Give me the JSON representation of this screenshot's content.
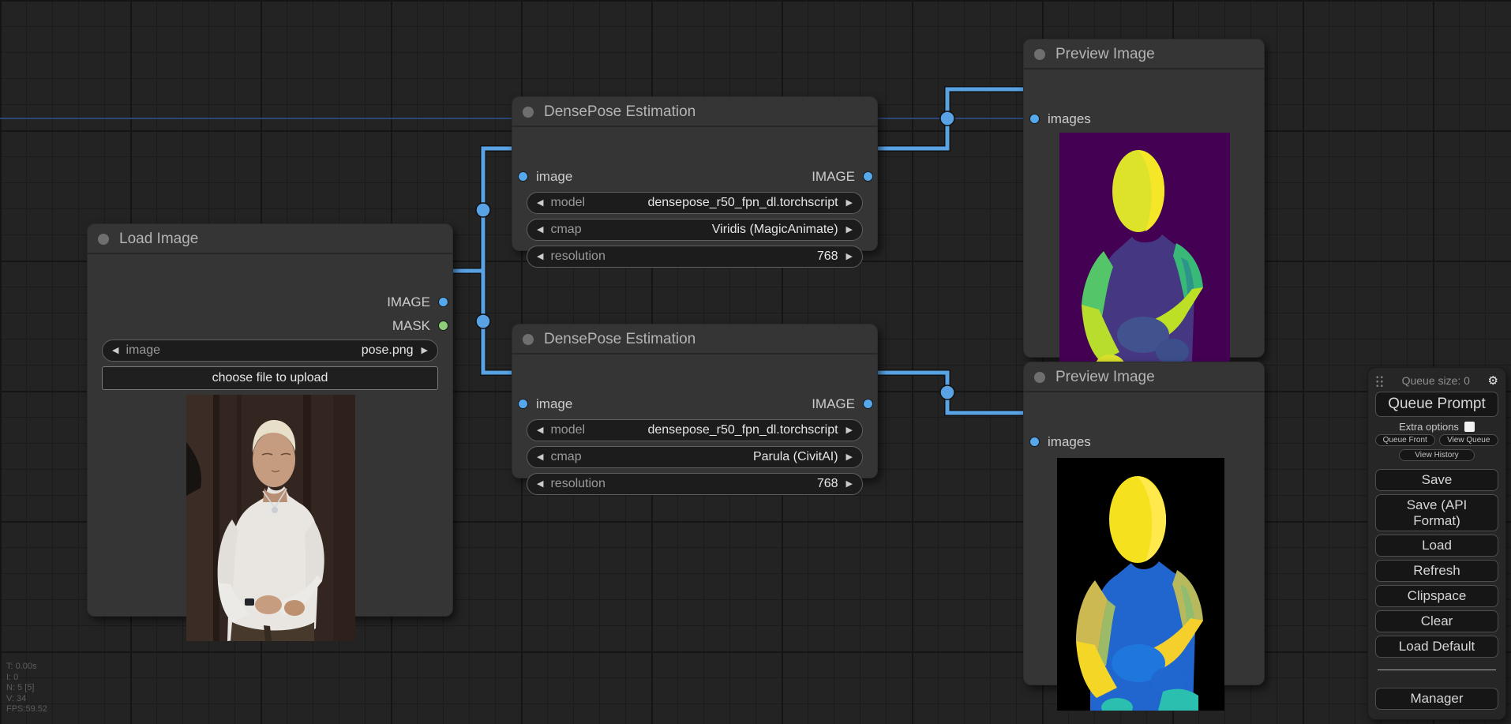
{
  "canvas": {
    "stats": [
      "T: 0.00s",
      "I: 0",
      "N: 5 [5]",
      "V: 34",
      "FPS:59.52"
    ]
  },
  "colors": {
    "link": "#59a2e4",
    "image_slot": "#55a8ec",
    "mask_slot": "#8fcc7a",
    "node_bg": "#353535",
    "canvas_bg": "#232323"
  },
  "nodes": {
    "load_image": {
      "title": "Load Image",
      "outputs": [
        {
          "label": "IMAGE"
        },
        {
          "label": "MASK"
        }
      ],
      "widgets": [
        {
          "label": "image",
          "value": "pose.png"
        }
      ],
      "upload_button": "choose file to upload",
      "image_name": "photo-man-white-shirt"
    },
    "densepose_1": {
      "title": "DensePose Estimation",
      "inputs": [
        {
          "label": "image"
        }
      ],
      "outputs": [
        {
          "label": "IMAGE"
        }
      ],
      "widgets": [
        {
          "label": "model",
          "value": "densepose_r50_fpn_dl.torchscript"
        },
        {
          "label": "cmap",
          "value": "Viridis (MagicAnimate)"
        },
        {
          "label": "resolution",
          "value": "768"
        }
      ]
    },
    "densepose_2": {
      "title": "DensePose Estimation",
      "inputs": [
        {
          "label": "image"
        }
      ],
      "outputs": [
        {
          "label": "IMAGE"
        }
      ],
      "widgets": [
        {
          "label": "model",
          "value": "densepose_r50_fpn_dl.torchscript"
        },
        {
          "label": "cmap",
          "value": "Parula (CivitAI)"
        },
        {
          "label": "resolution",
          "value": "768"
        }
      ]
    },
    "preview_1": {
      "title": "Preview Image",
      "inputs": [
        {
          "label": "images"
        }
      ],
      "image_name": "densepose-viridis-result"
    },
    "preview_2": {
      "title": "Preview Image",
      "inputs": [
        {
          "label": "images"
        }
      ],
      "image_name": "densepose-parula-result"
    }
  },
  "menu": {
    "queue_size": "Queue size: 0",
    "queue_prompt": "Queue Prompt",
    "extra_options": "Extra options",
    "queue_front": "Queue Front",
    "view_queue": "View Queue",
    "view_history": "View History",
    "save": "Save",
    "save_api": "Save (API Format)",
    "load": "Load",
    "refresh": "Refresh",
    "clipspace": "Clipspace",
    "clear": "Clear",
    "load_default": "Load Default",
    "manager": "Manager"
  }
}
